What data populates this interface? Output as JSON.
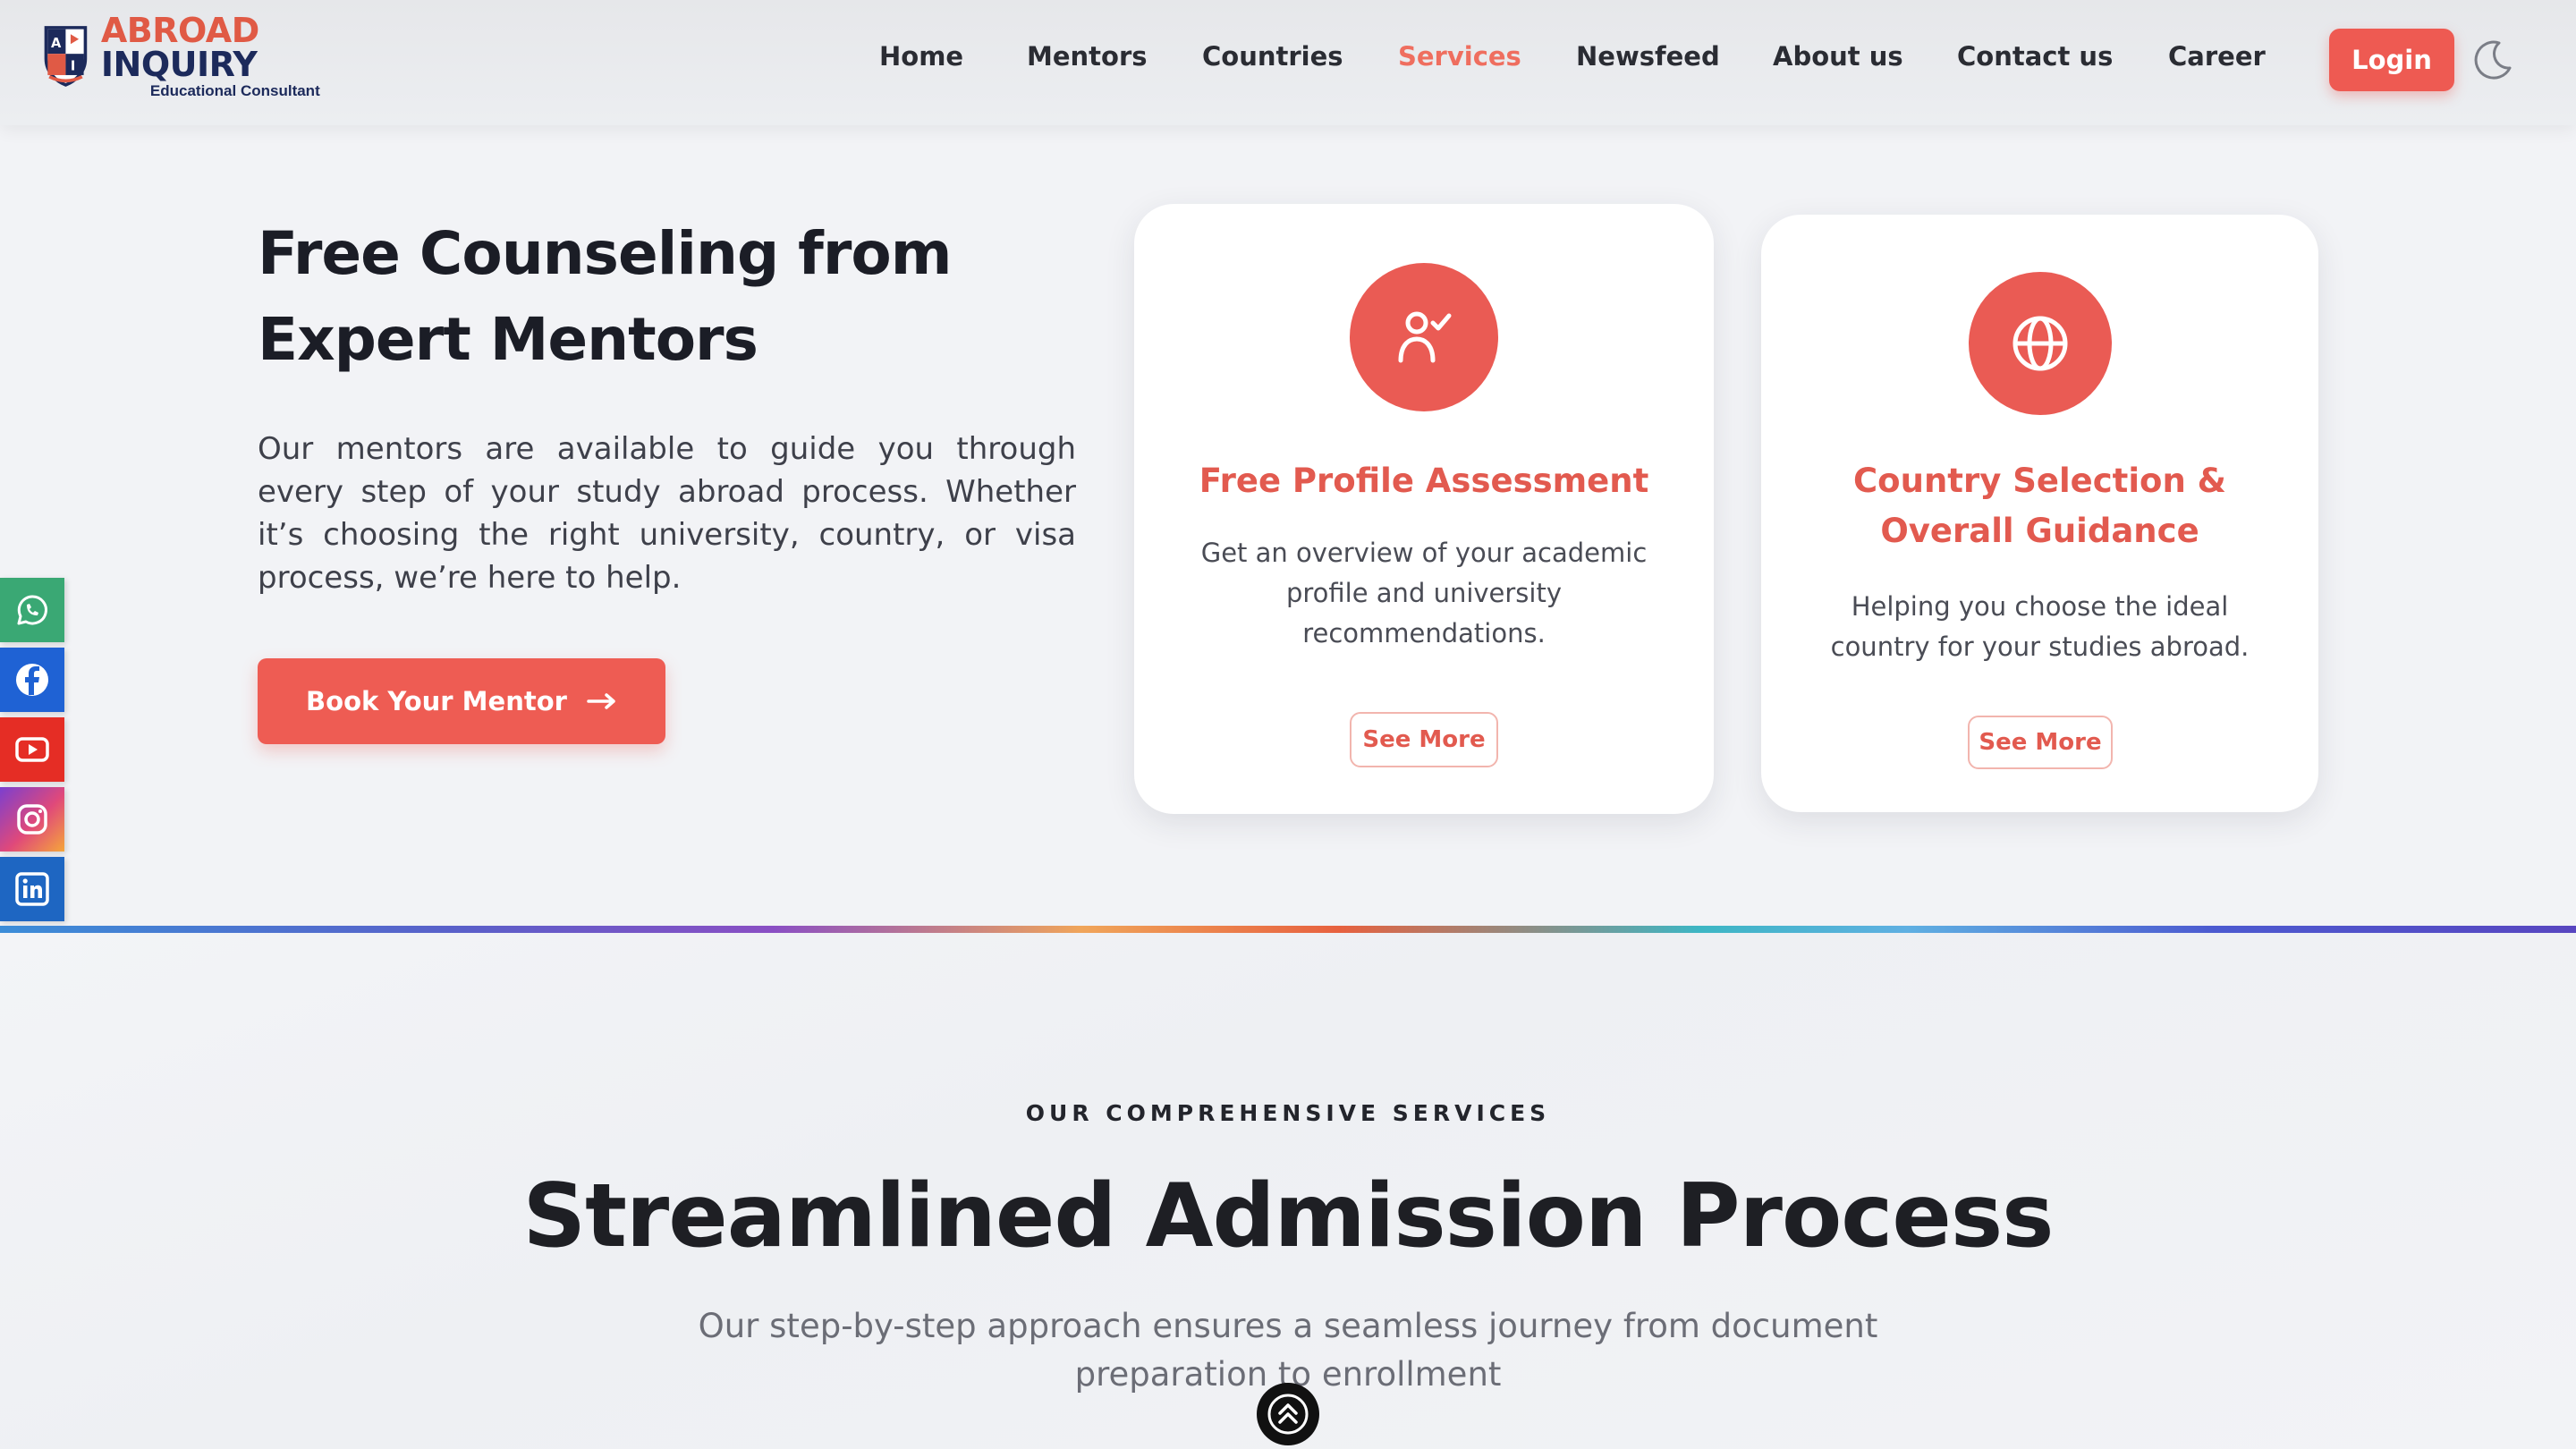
{
  "brand": {
    "name_part1": "ABROAD",
    "name_part2": "INQUIRY",
    "tagline": "Educational Consultant"
  },
  "nav": {
    "items": [
      {
        "label": "Home"
      },
      {
        "label": "Mentors"
      },
      {
        "label": "Countries"
      },
      {
        "label": "Services",
        "active": true
      },
      {
        "label": "Newsfeed"
      },
      {
        "label": "About us"
      },
      {
        "label": "Contact us"
      },
      {
        "label": "Career"
      }
    ],
    "login_label": "Login",
    "theme_icon": "moon-icon"
  },
  "hero": {
    "title": "Free Counseling from Expert Mentors",
    "text": "Our mentors are available to guide you through every step of your study abroad process. Whether it’s choosing the right university, country, or visa process, we’re here to help.",
    "cta_label": "Book Your Mentor",
    "cta_icon": "arrow-right-icon"
  },
  "cards": [
    {
      "icon": "user-check-icon",
      "title": "Free Profile Assessment",
      "description": "Get an overview of your academic profile and university recommendations.",
      "button_label": "See More"
    },
    {
      "icon": "globe-icon",
      "title": "Country Selection & Overall Guidance",
      "description": "Helping you choose the ideal country for your studies abroad.",
      "button_label": "See More"
    }
  ],
  "social": [
    "whatsapp-icon",
    "facebook-icon",
    "youtube-icon",
    "instagram-icon",
    "linkedin-icon"
  ],
  "services_section": {
    "eyebrow": "OUR COMPREHENSIVE SERVICES",
    "title": "Streamlined Admission Process",
    "subtitle": "Our step-by-step approach ensures a seamless journey from document preparation to enrollment"
  },
  "colors": {
    "accent": "#ee5a52",
    "accent_text": "#e25a4f",
    "brand_navy": "#1c2a5b",
    "background": "#f2f3f6"
  }
}
